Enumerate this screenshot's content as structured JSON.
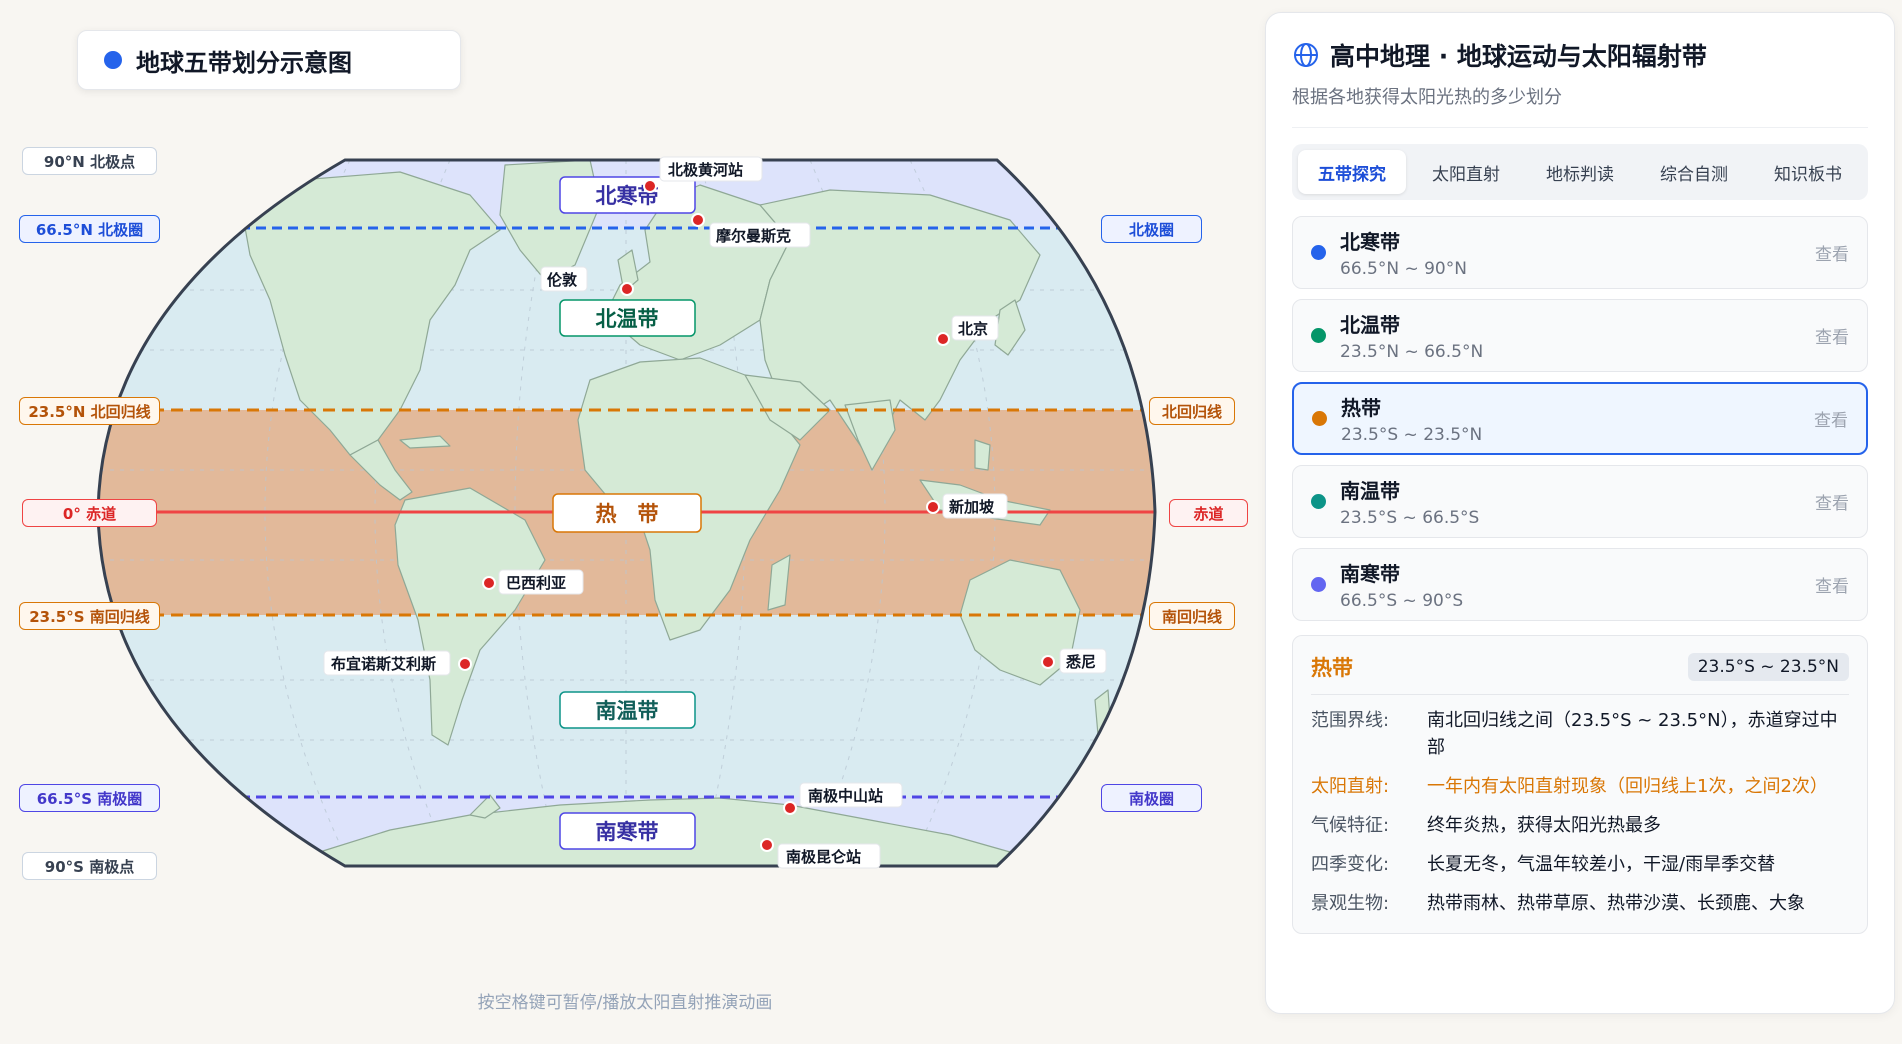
{
  "map": {
    "title": "地球五带划分示意图",
    "hint": "按空格键可暂停/播放太阳直射推演动画",
    "left_tags": {
      "np": "90°N 北极点",
      "ac": "66.5°N 北极圈",
      "toc": "23.5°N 北回归线",
      "eq": "0° 赤道",
      "tor": "23.5°S 南回归线",
      "antc": "66.5°S 南极圈",
      "sp": "90°S 南极点"
    },
    "right_tags": {
      "ac": "北极圈",
      "toc": "北回归线",
      "eq": "赤道",
      "tor": "南回归线",
      "antc": "南极圈"
    },
    "zone_labels": {
      "n_frigid": "北寒带",
      "n_temperate": "北温带",
      "tropic": "热　带",
      "s_temperate": "南温带",
      "s_frigid": "南寒带"
    },
    "cities": {
      "yellow_river": "北极黄河站",
      "murmansk": "摩尔曼斯克",
      "london": "伦敦",
      "beijing": "北京",
      "singapore": "新加坡",
      "brasilia": "巴西利亚",
      "buenos_aires": "布宜诺斯艾利斯",
      "sydney": "悉尼",
      "zhongshan": "南极中山站",
      "kunlun": "南极昆仑站"
    },
    "colors": {
      "frigid": "#dde3fb",
      "temperate": "#d9ebf1",
      "tropic": "#e2b99a",
      "land": "#d5ead6",
      "equator": "#ef4444",
      "tropic_line": "#d97706",
      "polar_line": "#2563eb",
      "city": "#dc2626"
    }
  },
  "panel": {
    "title": "高中地理 · 地球运动与太阳辐射带",
    "subtitle": "根据各地获得太阳光热的多少划分",
    "tabs": [
      "五带探究",
      "太阳直射",
      "地标判读",
      "综合自测",
      "知识板书"
    ],
    "zones": [
      {
        "name": "北寒带",
        "range": "66.5°N ~ 90°N",
        "view": "查看",
        "color": "#2563eb"
      },
      {
        "name": "北温带",
        "range": "23.5°N ~ 66.5°N",
        "view": "查看",
        "color": "#059669"
      },
      {
        "name": "热带",
        "range": "23.5°S ~ 23.5°N",
        "view": "查看",
        "color": "#d97706"
      },
      {
        "name": "南温带",
        "range": "23.5°S ~ 66.5°S",
        "view": "查看",
        "color": "#0d9488"
      },
      {
        "name": "南寒带",
        "range": "66.5°S ~ 90°S",
        "view": "查看",
        "color": "#6366f1"
      }
    ],
    "detail": {
      "name": "热带",
      "badge": "23.5°S ~ 23.5°N",
      "rows": [
        {
          "label": "范围界线:",
          "value": "南北回归线之间（23.5°S ~ 23.5°N），赤道穿过中部"
        },
        {
          "label": "太阳直射:",
          "value": "一年内有太阳直射现象（回归线上1次，之间2次）"
        },
        {
          "label": "气候特征:",
          "value": "终年炎热，获得太阳光热最多"
        },
        {
          "label": "四季变化:",
          "value": "长夏无冬，气温年较差小，干湿/雨旱季交替"
        },
        {
          "label": "景观生物:",
          "value": "热带雨林、热带草原、热带沙漠、长颈鹿、大象"
        }
      ]
    }
  }
}
